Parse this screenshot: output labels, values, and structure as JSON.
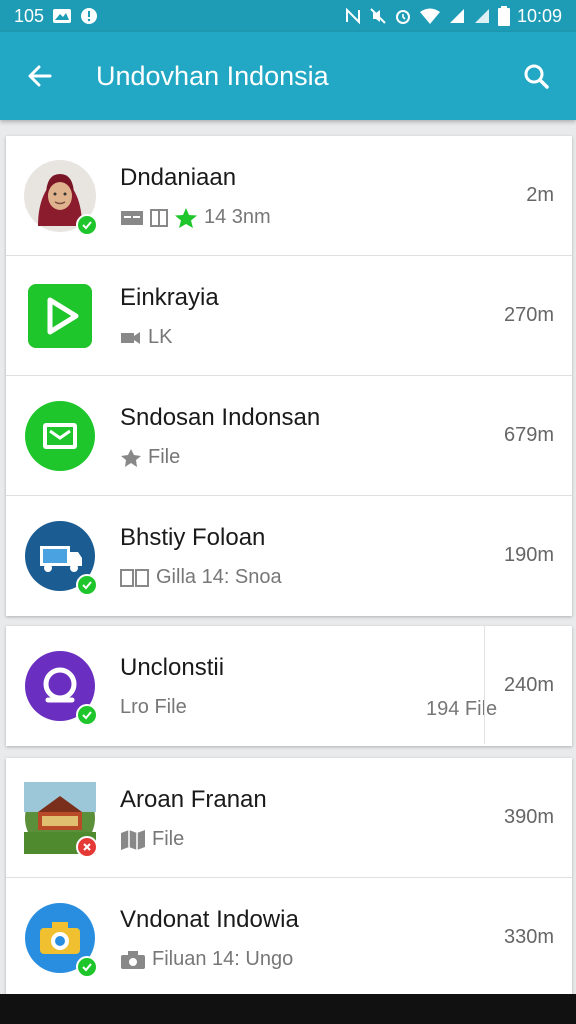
{
  "status": {
    "left_text": "105",
    "time": "10:09",
    "left_icons": [
      "image-icon",
      "notification-icon"
    ],
    "right_icons": [
      "nfc-icon",
      "mute-icon",
      "alarm-icon",
      "wifi-icon",
      "signal-icon",
      "signal-icon",
      "battery-icon"
    ]
  },
  "appbar": {
    "title": "Undovhan Indonsia",
    "back_icon": "arrow-left-icon",
    "action_icon": "search-icon",
    "color": "#22a8c4"
  },
  "items": [
    {
      "name": "Dndaniaan",
      "sub": "14 3nm",
      "time": "2m",
      "avatar": "person-photo",
      "badge": "check",
      "sub_icons": [
        "card-icon",
        "doc-icon",
        "star-icon"
      ]
    },
    {
      "name": "Einkrayia",
      "sub": "LK",
      "time": "270m",
      "avatar": "play-icon",
      "badge": "",
      "sub_icons": [
        "video-icon"
      ]
    },
    {
      "name": "Sndosan Indonsan",
      "sub": "File",
      "time": "679m",
      "avatar": "mail-icon",
      "badge": "",
      "sub_icons": [
        "pin-icon"
      ]
    },
    {
      "name": "Bhstiy Foloan",
      "sub": "Gilla 14: Snoa",
      "time": "190m",
      "avatar": "truck-icon",
      "badge": "check",
      "sub_icons": [
        "doc-icon"
      ]
    },
    {
      "name": "Unclonstii",
      "sub": "Lro File",
      "time": "240m",
      "extra": "194 File",
      "avatar": "search-circle-icon",
      "badge": "check",
      "sub_icons": []
    },
    {
      "name": "Aroan Franan",
      "sub": "File",
      "time": "390m",
      "avatar": "house-photo",
      "badge": "alert",
      "sub_icons": [
        "map-icon"
      ]
    },
    {
      "name": "Vndonat Indowia",
      "sub": "Filuan 14: Ungo",
      "time": "330m",
      "avatar": "camera-icon",
      "badge": "check",
      "sub_icons": [
        "camera-icon"
      ]
    }
  ],
  "colors": {
    "accent": "#22a8c4",
    "status_bar": "#1e9cb5",
    "green": "#1ec62b",
    "purple": "#6a2fc0",
    "navy": "#1b5c93",
    "red": "#e53935"
  }
}
